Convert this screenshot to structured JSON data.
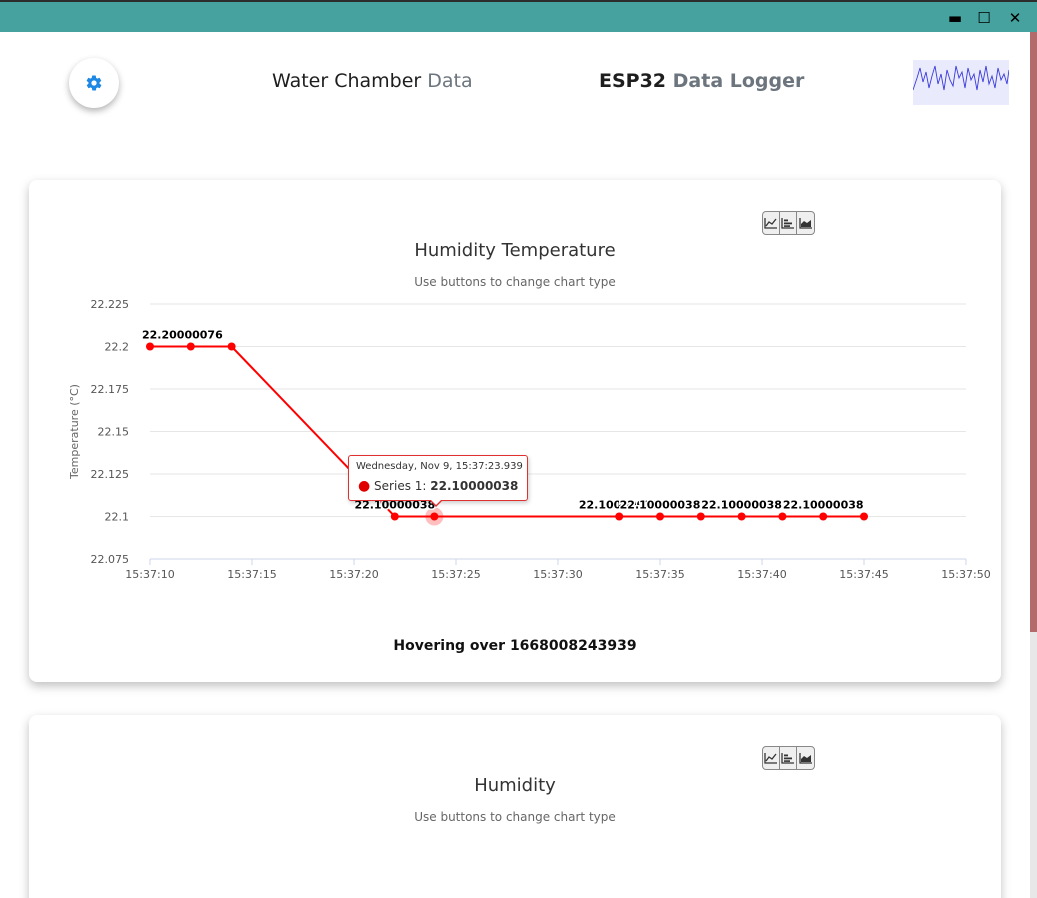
{
  "window": {
    "minimize": "▬",
    "maximize": "☐",
    "close": "✕"
  },
  "header": {
    "left_title_main": "Water Chamber",
    "left_title_muted": "Data",
    "right_title_main": "ESP32",
    "right_title_muted": "Data Logger",
    "settings_icon": "gear-icon",
    "accent_color": "#1e88e5"
  },
  "cards": [
    {
      "title": "Humidity Temperature",
      "subtitle": "Use buttons to change chart type",
      "hover_text": "Hovering over 1668008243939",
      "tooltip": {
        "date": "Wednesday, Nov 9, 15:37:23.939",
        "series_label": "Series 1:",
        "value": "22.10000038"
      }
    },
    {
      "title": "Humidity",
      "subtitle": "Use buttons to change chart type"
    }
  ],
  "chart_data": {
    "type": "line",
    "title": "Humidity Temperature",
    "subtitle": "Use buttons to change chart type",
    "xlabel": "",
    "ylabel": "Temperature (°C)",
    "color": "#ff0000",
    "x_ticks": [
      "15:37:10",
      "15:37:15",
      "15:37:20",
      "15:37:25",
      "15:37:30",
      "15:37:35",
      "15:37:40",
      "15:37:45",
      "15:37:50"
    ],
    "y_ticks": [
      "22.075",
      "22.1",
      "22.125",
      "22.15",
      "22.175",
      "22.2",
      "22.225"
    ],
    "xlim": [
      "15:37:10",
      "15:37:50"
    ],
    "ylim": [
      22.075,
      22.225
    ],
    "legend": "bottom",
    "grid": true,
    "series": [
      {
        "name": "Series 1",
        "x": [
          "15:37:10.0",
          "15:37:12.0",
          "15:37:14.0",
          "15:37:22.0",
          "15:37:23.939",
          "15:37:33.0",
          "15:37:35.0",
          "15:37:37.0",
          "15:37:39.0",
          "15:37:41.0",
          "15:37:43.0",
          "15:37:45.0"
        ],
        "values": [
          22.20000076,
          22.20000076,
          22.20000076,
          22.10000038,
          22.10000038,
          22.10000038,
          22.10000038,
          22.10000038,
          22.10000038,
          22.10000038,
          22.10000038,
          22.10000038
        ],
        "labels": [
          "22.20000076",
          "",
          "",
          "22.10000038",
          "",
          "22.10000038",
          "22.10000038",
          "",
          "22.10000038",
          "",
          "22.10000038",
          ""
        ]
      }
    ],
    "highlighted_index": 4
  }
}
